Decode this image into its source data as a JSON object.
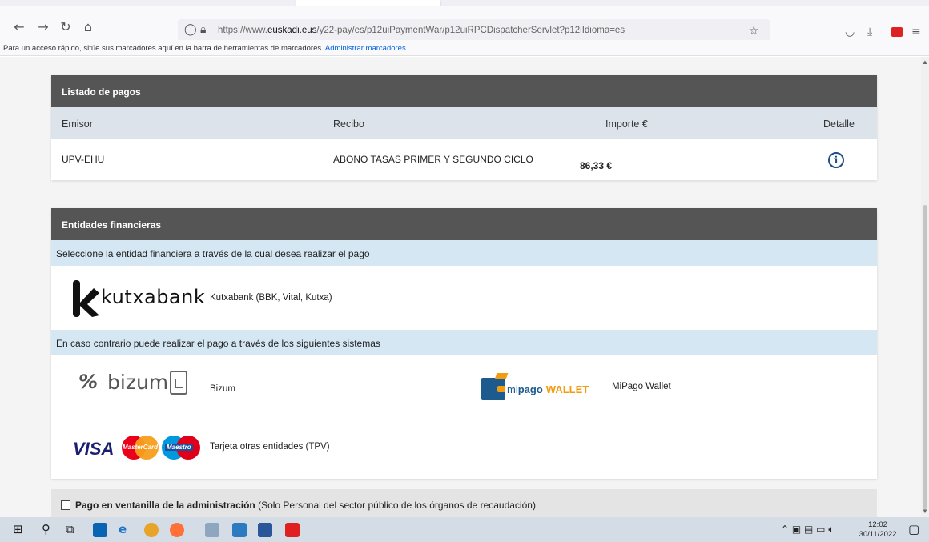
{
  "browser": {
    "url_prefix": "https://www.",
    "url_domain": "euskadi.eus",
    "url_path": "/y22-pay/es/p12uiPaymentWar/p12uiRPCDispatcherServlet?p12iIdioma=es",
    "bookmarks_text": "Para un acceso rápido, sitúe sus marcadores aquí en la barra de herramientas de marcadores.",
    "bookmarks_link": "Administrar marcadores..."
  },
  "payments": {
    "title": "Listado de pagos",
    "columns": [
      "Emisor",
      "Recibo",
      "Importe €",
      "Detalle"
    ],
    "rows": [
      {
        "emisor": "UPV-EHU",
        "recibo": "ABONO TASAS PRIMER Y SEGUNDO CICLO",
        "importe": "86,33 €"
      }
    ]
  },
  "entities": {
    "title": "Entidades financieras",
    "select_prompt": "Seleccione la entidad financiera a través de la cual desea realizar el pago",
    "kutxabank_logo_text": "kutxabank",
    "kutxabank_label": "Kutxabank (BBK, Vital, Kutxa)",
    "alt_prompt": "En caso contrario puede realizar el pago a través de los siguientes sistemas",
    "bizum_logo_text": "bizum",
    "bizum_label": "Bizum",
    "mipago_logo_mi": "mi",
    "mipago_logo_pago": "pago",
    "mipago_logo_wallet": "WALLET",
    "mipago_label": "MiPago Wallet",
    "visa_text": "VISA",
    "mastercard_text": "MasterCard",
    "maestro_text": "Maestro",
    "tpv_label": "Tarjeta otras entidades (TPV)"
  },
  "ventanilla": {
    "bold": "Pago en ventanilla de la administración",
    "rest": " (Solo Personal del sector público de los órganos de recaudación)"
  },
  "taskbar": {
    "time": "12:02",
    "date": "30/11/2022"
  },
  "colors": {
    "header_bg": "#555555",
    "band_bg": "#d4e7f3",
    "info_icon": "#1a4f8b"
  }
}
